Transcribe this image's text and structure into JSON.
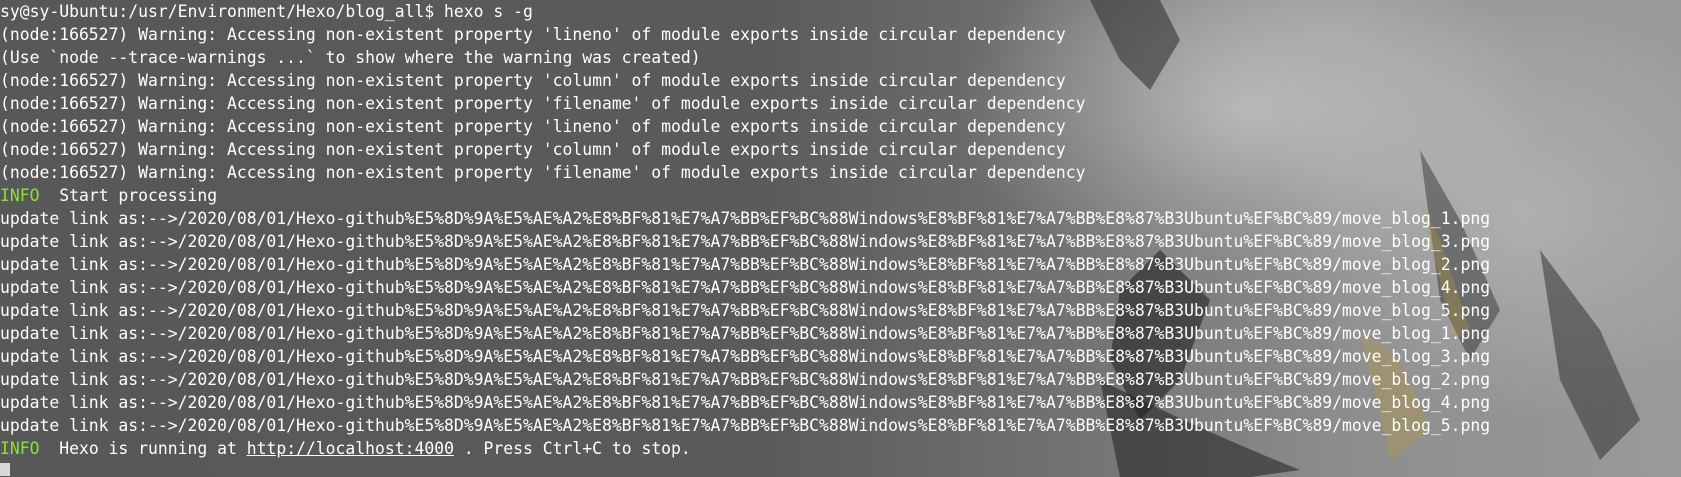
{
  "terminal": {
    "prompt_line": "sy@sy-Ubuntu:/usr/Environment/Hexo/blog_all$ hexo s -g",
    "warnings": [
      "(node:166527) Warning: Accessing non-existent property 'lineno' of module exports inside circular dependency",
      "(Use `node --trace-warnings ...` to show where the warning was created)",
      "(node:166527) Warning: Accessing non-existent property 'column' of module exports inside circular dependency",
      "(node:166527) Warning: Accessing non-existent property 'filename' of module exports inside circular dependency",
      "(node:166527) Warning: Accessing non-existent property 'lineno' of module exports inside circular dependency",
      "(node:166527) Warning: Accessing non-existent property 'column' of module exports inside circular dependency",
      "(node:166527) Warning: Accessing non-existent property 'filename' of module exports inside circular dependency"
    ],
    "info_start": {
      "tag": "INFO",
      "text": "  Start processing"
    },
    "updates": [
      "update link as:-->/2020/08/01/Hexo-github%E5%8D%9A%E5%AE%A2%E8%BF%81%E7%A7%BB%EF%BC%88Windows%E8%BF%81%E7%A7%BB%E8%87%B3Ubuntu%EF%BC%89/move_blog_1.png",
      "update link as:-->/2020/08/01/Hexo-github%E5%8D%9A%E5%AE%A2%E8%BF%81%E7%A7%BB%EF%BC%88Windows%E8%BF%81%E7%A7%BB%E8%87%B3Ubuntu%EF%BC%89/move_blog_3.png",
      "update link as:-->/2020/08/01/Hexo-github%E5%8D%9A%E5%AE%A2%E8%BF%81%E7%A7%BB%EF%BC%88Windows%E8%BF%81%E7%A7%BB%E8%87%B3Ubuntu%EF%BC%89/move_blog_2.png",
      "update link as:-->/2020/08/01/Hexo-github%E5%8D%9A%E5%AE%A2%E8%BF%81%E7%A7%BB%EF%BC%88Windows%E8%BF%81%E7%A7%BB%E8%87%B3Ubuntu%EF%BC%89/move_blog_4.png",
      "update link as:-->/2020/08/01/Hexo-github%E5%8D%9A%E5%AE%A2%E8%BF%81%E7%A7%BB%EF%BC%88Windows%E8%BF%81%E7%A7%BB%E8%87%B3Ubuntu%EF%BC%89/move_blog_5.png",
      "update link as:-->/2020/08/01/Hexo-github%E5%8D%9A%E5%AE%A2%E8%BF%81%E7%A7%BB%EF%BC%88Windows%E8%BF%81%E7%A7%BB%E8%87%B3Ubuntu%EF%BC%89/move_blog_1.png",
      "update link as:-->/2020/08/01/Hexo-github%E5%8D%9A%E5%AE%A2%E8%BF%81%E7%A7%BB%EF%BC%88Windows%E8%BF%81%E7%A7%BB%E8%87%B3Ubuntu%EF%BC%89/move_blog_3.png",
      "update link as:-->/2020/08/01/Hexo-github%E5%8D%9A%E5%AE%A2%E8%BF%81%E7%A7%BB%EF%BC%88Windows%E8%BF%81%E7%A7%BB%E8%87%B3Ubuntu%EF%BC%89/move_blog_2.png",
      "update link as:-->/2020/08/01/Hexo-github%E5%8D%9A%E5%AE%A2%E8%BF%81%E7%A7%BB%EF%BC%88Windows%E8%BF%81%E7%A7%BB%E8%87%B3Ubuntu%EF%BC%89/move_blog_4.png",
      "update link as:-->/2020/08/01/Hexo-github%E5%8D%9A%E5%AE%A2%E8%BF%81%E7%A7%BB%EF%BC%88Windows%E8%BF%81%E7%A7%BB%E8%87%B3Ubuntu%EF%BC%89/move_blog_5.png"
    ],
    "info_running": {
      "tag": "INFO",
      "prefix": "  Hexo is running at ",
      "url": "http://localhost:4000",
      "suffix": " . Press Ctrl+C to stop."
    }
  },
  "colors": {
    "text": "#ffffff",
    "info_tag": "#8ae234"
  }
}
